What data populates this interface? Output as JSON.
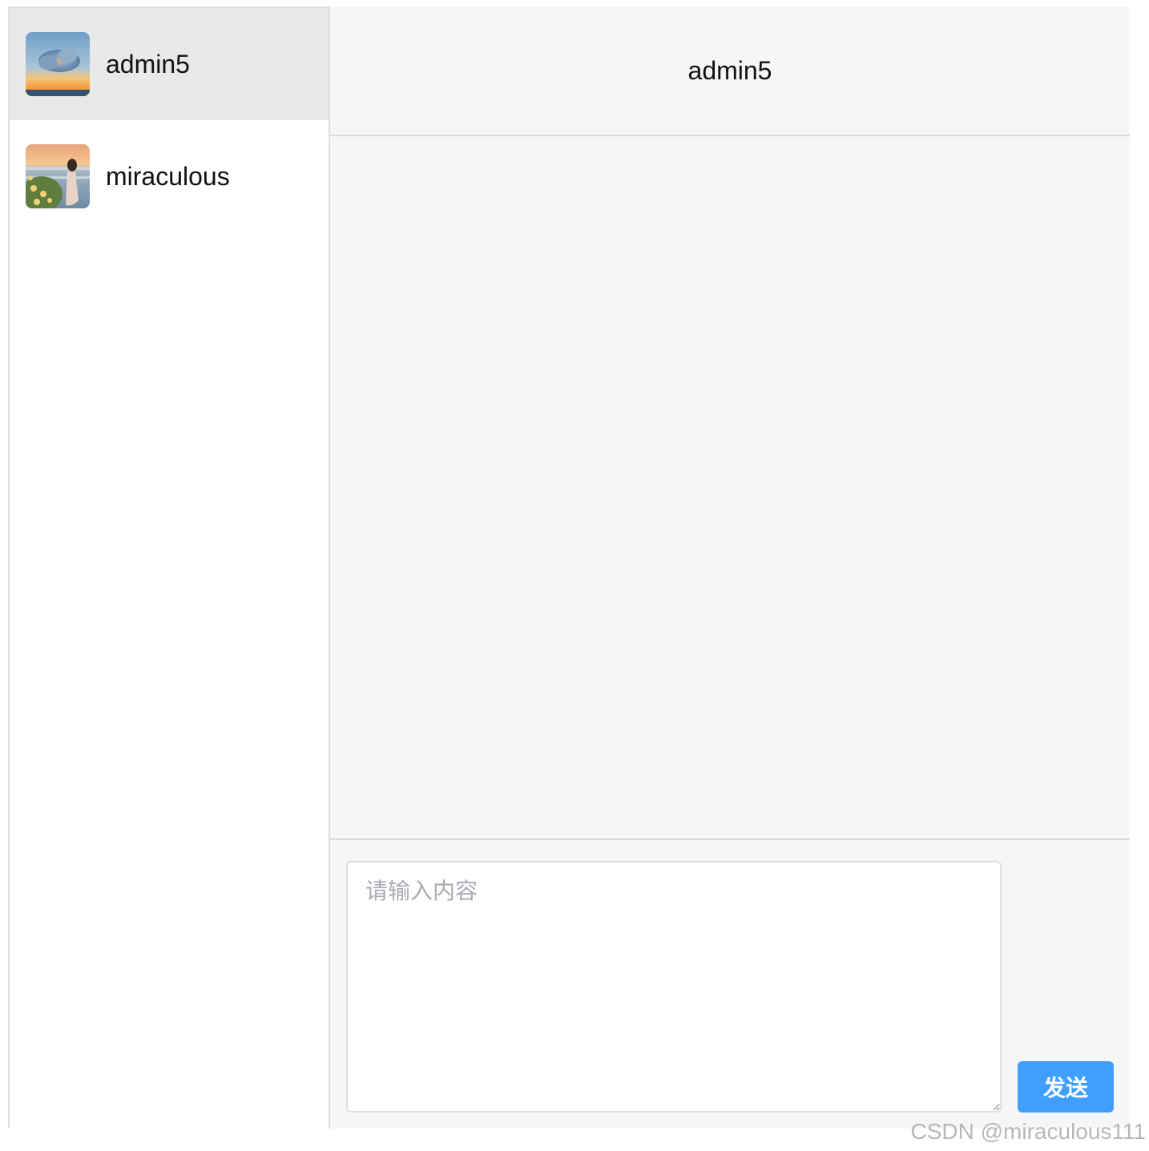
{
  "contacts": [
    {
      "name": "admin5",
      "avatar": "cloud-sunset-avatar",
      "active": true
    },
    {
      "name": "miraculous",
      "avatar": "girl-flowers-sea-avatar",
      "active": false
    }
  ],
  "chat": {
    "title": "admin5"
  },
  "composer": {
    "placeholder": "请输入内容",
    "send_label": "发送"
  },
  "watermark": "CSDN @miraculous111",
  "colors": {
    "active_contact_bg": "#e8eaea",
    "main_bg": "#f5f7f6",
    "send_button": "#409eff"
  }
}
